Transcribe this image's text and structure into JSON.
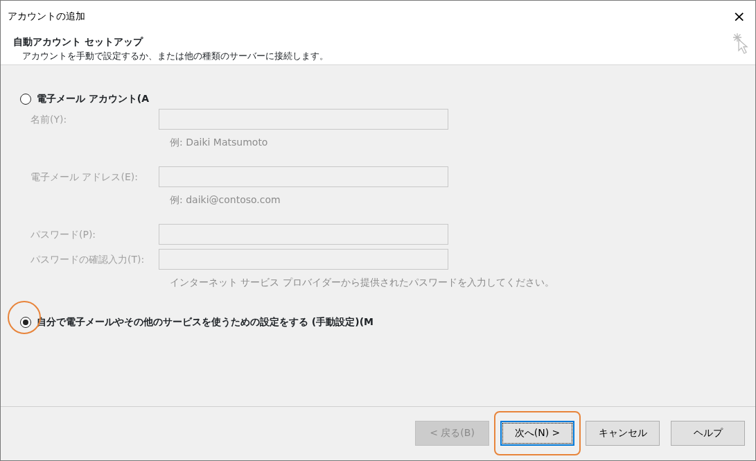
{
  "window": {
    "title": "アカウントの追加",
    "close": "×"
  },
  "header": {
    "title": "自動アカウント セットアップ",
    "subtitle": "アカウントを手動で設定するか、または他の種類のサーバーに接続します。"
  },
  "options": [
    {
      "label": "電子メール アカウント(A",
      "selected": false,
      "highlighted": false,
      "fields": [
        {
          "label": "名前(Y):",
          "disabled": true,
          "hint": "例: Daiki Matsumoto"
        },
        {
          "label": "電子メール アドレス(E):",
          "disabled": true,
          "hint": "例: daiki@contoso.com"
        },
        {
          "label": "パスワード(P):",
          "disabled": true
        },
        {
          "label": "パスワードの確認入力(T):",
          "disabled": true,
          "hint": "インターネット サービス プロバイダーから提供されたパスワードを入力してください。"
        }
      ]
    },
    {
      "label": "自分で電子メールやその他のサービスを使うための設定をする (手動設定)(M",
      "selected": true,
      "highlighted": true
    }
  ],
  "buttons": [
    {
      "label": "< 戻る(B)",
      "disabled": true,
      "focused": false,
      "highlighted": false
    },
    {
      "label": "次へ(N) >",
      "disabled": false,
      "focused": true,
      "highlighted": true
    },
    {
      "label": "キャンセル",
      "disabled": false,
      "focused": false,
      "highlighted": false
    },
    {
      "label": "ヘルプ",
      "disabled": false,
      "focused": false,
      "highlighted": false
    }
  ]
}
